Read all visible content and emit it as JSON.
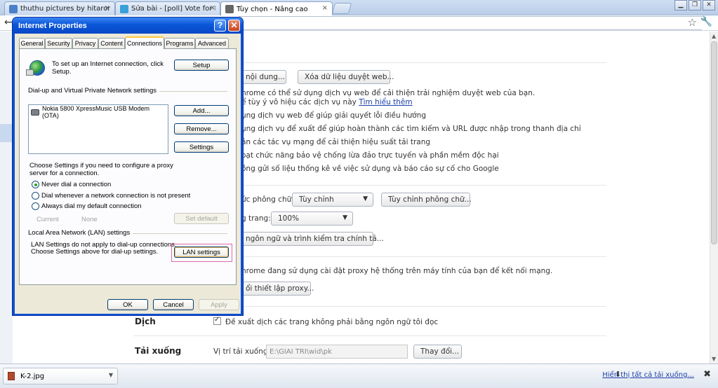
{
  "browser": {
    "tabs": [
      {
        "title": "thuthu pictures by hitaromiyar",
        "favicon_color": "#4a7fc9"
      },
      {
        "title": "Sửa bài - [poll] Vote for Kim Hy",
        "favicon_color": "#3aa0d8"
      },
      {
        "title": "Tùy chọn - Nâng cao",
        "favicon_color": "#666666"
      }
    ],
    "tab_close_glyph": "×",
    "window_buttons": [
      "▁",
      "❐",
      "✕"
    ]
  },
  "settings": {
    "privacy_buttons": {
      "content_settings": "nội dung...",
      "clear_data": "Xóa dữ liệu duyệt web..."
    },
    "privacy_intro_1": "hrome có thể sử dụng dịch vụ web để cải thiện trải nghiệm duyệt web của bạn.",
    "privacy_intro_2": "ể tùy ý vô hiệu các dịch vụ này",
    "learn_more": "Tìm hiểu thêm",
    "privacy_options": [
      "ụng dịch vụ web để giúp giải quyết lỗi điều hướng",
      "ụng dịch vụ để xuất để giúp hoàn thành các tìm kiếm và URL được nhập trong thanh địa chỉ",
      "án các tác vụ mạng để cải thiện hiệu suất tải trang",
      "oạt chức năng bảo vệ chống lừa đảo trực tuyến và phần mềm độc hại",
      "ồng gửi số liệu thống kê về việc sử dụng và báo cáo sự cố cho Google"
    ],
    "font_size_label": "ức phông chữ:",
    "font_size_value": "Tùy chỉnh",
    "customize_fonts": "Tùy chỉnh phông chữ...",
    "zoom_label": "g trang:",
    "zoom_value": "100%",
    "language_button": "ngôn ngữ và trình kiểm tra chính tả...",
    "proxy_text": "hrome đang sử dụng cài đặt proxy hệ thống trên máy tính của bạn để kết nối mạng.",
    "proxy_button": "ổi thiết lập proxy...",
    "translate_title": "Dịch",
    "translate_option": "Đề xuất dịch các trang không phải bằng ngôn ngữ tôi đọc",
    "downloads_title": "Tải xuống",
    "download_location_label": "Vị trí tải xuống:",
    "download_location_value": "E:\\GIAI TRI\\wid\\pk",
    "change_button": "Thay đổi..."
  },
  "download_shelf": {
    "file_name": "K-2.jpg",
    "show_all": "Hiển thị tất cả tải xuống...",
    "close_glyph": "✖"
  },
  "dialog": {
    "title": "Internet Properties",
    "help_glyph": "?",
    "close_glyph": "✕",
    "tabs": [
      "General",
      "Security",
      "Privacy",
      "Content",
      "Connections",
      "Programs",
      "Advanced"
    ],
    "active_tab": "Connections",
    "setup_text_1": "To set up an Internet connection, click",
    "setup_text_2": "Setup.",
    "setup_button": "Setup",
    "dialup_group": "Dial-up and Virtual Private Network settings",
    "dialup_items": [
      "Nokia 5800 XpressMusic USB Modem (OTA)"
    ],
    "add_button": "Add...",
    "remove_button": "Remove...",
    "settings_button": "Settings",
    "choose_text_1": "Choose Settings if you need to configure a proxy",
    "choose_text_2": "server for a connection.",
    "radio_options": [
      "Never dial a connection",
      "Dial whenever a network connection is not present",
      "Always dial my default connection"
    ],
    "selected_radio": 0,
    "current_label": "Current",
    "current_value": "None",
    "set_default_button": "Set default",
    "lan_group": "Local Area Network (LAN) settings",
    "lan_text_1": "LAN Settings do not apply to dial-up connections.",
    "lan_text_2": "Choose Settings above for dial-up settings.",
    "lan_button": "LAN settings",
    "ok_button": "OK",
    "cancel_button": "Cancel",
    "apply_button": "Apply"
  }
}
